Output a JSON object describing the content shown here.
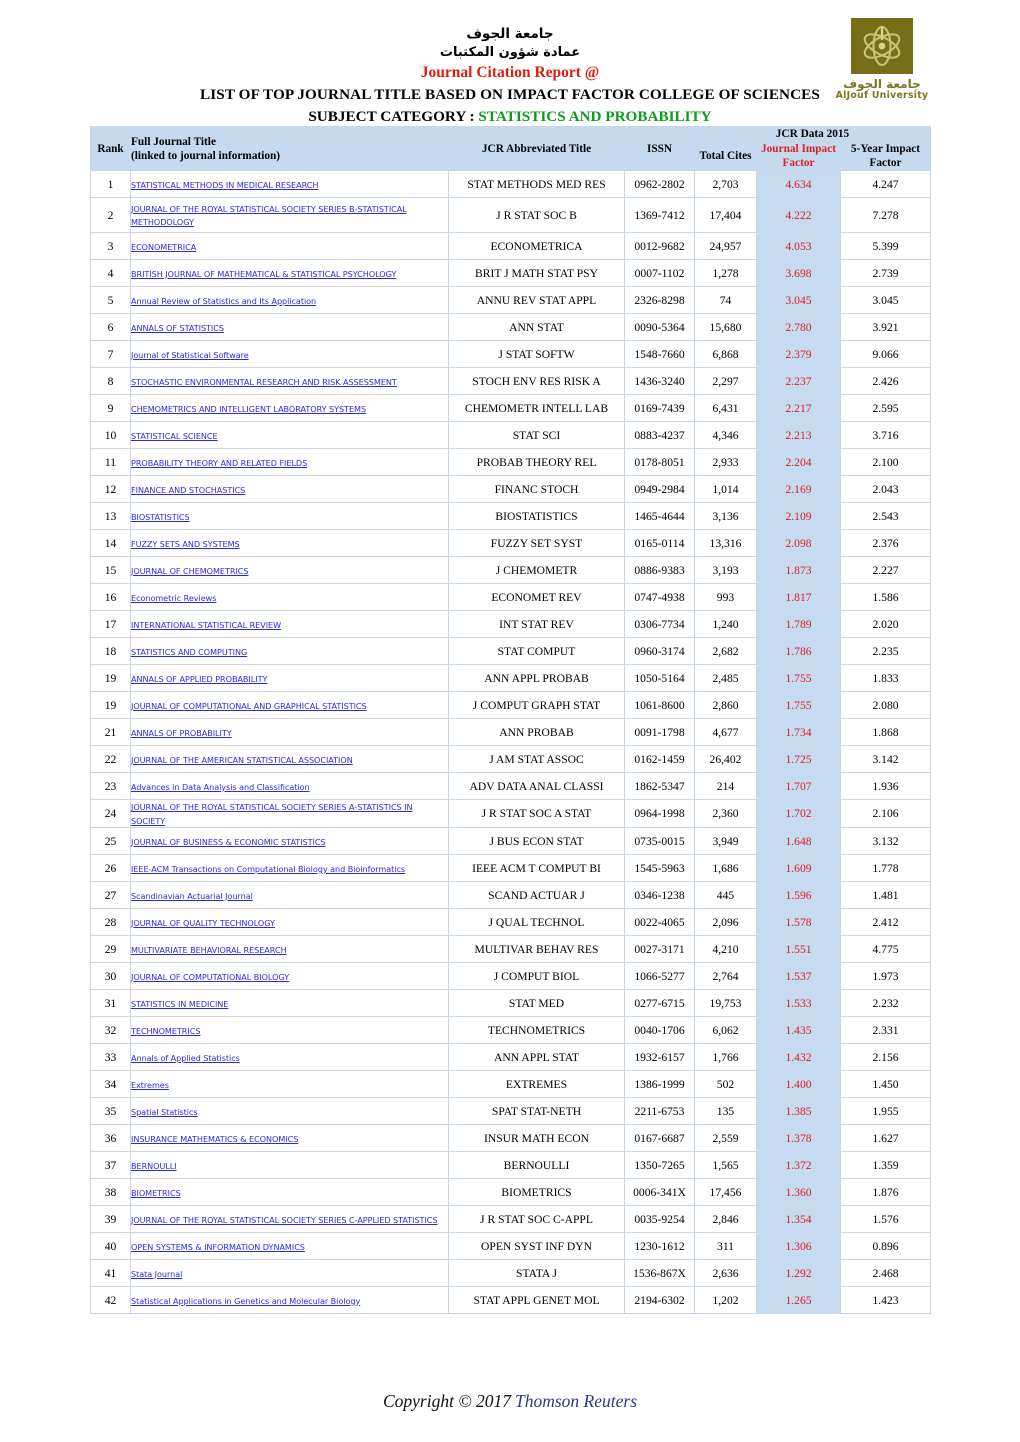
{
  "header": {
    "arabic_line1": "جامعة الجوف",
    "arabic_line2": "عمادة شؤون المكتبات",
    "report_title": "Journal Citation Report @",
    "list_title": "LIST OF TOP JOURNAL TITLE BASED ON IMPACT FACTOR COLLEGE OF SCIENCES",
    "subject_label": "SUBJECT CATEGORY :",
    "subject_value": "STATISTICS AND PROBABILITY",
    "colors": {
      "report_title": "#d91f11",
      "subject_value": "#0f9b1d",
      "logo": "#766f17",
      "impact_factor": "#e02020",
      "header_fill": "#c5d9ef",
      "jif_column_fill": "#c6daf0",
      "link": "#2b2bdd"
    }
  },
  "logo": {
    "arabic_name": "جامعة الجوف",
    "english_name": "AlJouf University"
  },
  "table": {
    "group_header": "JCR Data 2015",
    "columns": {
      "rank": "Rank",
      "full_title_line1": "Full Journal Title",
      "full_title_line2": "(linked to journal information)",
      "abbrev": "JCR Abbreviated Title",
      "issn": "ISSN",
      "total_cites": "Total Cites",
      "jif_line1": "Journal Impact",
      "jif_line2": "Factor",
      "fyif_line1": "5-Year Impact",
      "fyif_line2": "Factor"
    },
    "rows": [
      {
        "rank": "1",
        "title": "STATISTICAL METHODS IN MEDICAL RESEARCH",
        "abbr": "STAT METHODS MED RES",
        "issn": "0962-2802",
        "cites": "2,703",
        "jif": "4.634",
        "fyif": "4.247"
      },
      {
        "rank": "2",
        "title": "JOURNAL OF THE ROYAL STATISTICAL SOCIETY SERIES B-STATISTICAL METHODOLOGY",
        "abbr": "J R STAT SOC B",
        "issn": "1369-7412",
        "cites": "17,404",
        "jif": "4.222",
        "fyif": "7.278",
        "tall": true
      },
      {
        "rank": "3",
        "title": "ECONOMETRICA",
        "abbr": "ECONOMETRICA",
        "issn": "0012-9682",
        "cites": "24,957",
        "jif": "4.053",
        "fyif": "5.399"
      },
      {
        "rank": "4",
        "title": "BRITISH JOURNAL OF MATHEMATICAL & STATISTICAL PSYCHOLOGY",
        "abbr": "BRIT J MATH STAT PSY",
        "issn": "0007-1102",
        "cites": "1,278",
        "jif": "3.698",
        "fyif": "2.739"
      },
      {
        "rank": "5",
        "title": "Annual Review of Statistics and Its Application",
        "abbr": "ANNU REV STAT APPL",
        "issn": "2326-8298",
        "cites": "74",
        "jif": "3.045",
        "fyif": "3.045"
      },
      {
        "rank": "6",
        "title": "ANNALS OF STATISTICS",
        "abbr": "ANN STAT",
        "issn": "0090-5364",
        "cites": "15,680",
        "jif": "2.780",
        "fyif": "3.921"
      },
      {
        "rank": "7",
        "title": "Journal of Statistical Software",
        "abbr": "J STAT SOFTW",
        "issn": "1548-7660",
        "cites": "6,868",
        "jif": "2.379",
        "fyif": "9.066"
      },
      {
        "rank": "8",
        "title": "STOCHASTIC ENVIRONMENTAL RESEARCH AND RISK ASSESSMENT",
        "abbr": "STOCH ENV RES RISK A",
        "issn": "1436-3240",
        "cites": "2,297",
        "jif": "2.237",
        "fyif": "2.426"
      },
      {
        "rank": "9",
        "title": "CHEMOMETRICS AND INTELLIGENT LABORATORY SYSTEMS",
        "abbr": "CHEMOMETR INTELL LAB",
        "issn": "0169-7439",
        "cites": "6,431",
        "jif": "2.217",
        "fyif": "2.595"
      },
      {
        "rank": "10",
        "title": "STATISTICAL SCIENCE",
        "abbr": "STAT SCI",
        "issn": "0883-4237",
        "cites": "4,346",
        "jif": "2.213",
        "fyif": "3.716"
      },
      {
        "rank": "11",
        "title": "PROBABILITY THEORY AND RELATED FIELDS",
        "abbr": "PROBAB THEORY REL",
        "issn": "0178-8051",
        "cites": "2,933",
        "jif": "2.204",
        "fyif": "2.100"
      },
      {
        "rank": "12",
        "title": "FINANCE AND STOCHASTICS",
        "abbr": "FINANC STOCH",
        "issn": "0949-2984",
        "cites": "1,014",
        "jif": "2.169",
        "fyif": "2.043"
      },
      {
        "rank": "13",
        "title": "BIOSTATISTICS",
        "abbr": "BIOSTATISTICS",
        "issn": "1465-4644",
        "cites": "3,136",
        "jif": "2.109",
        "fyif": "2.543"
      },
      {
        "rank": "14",
        "title": "FUZZY SETS AND SYSTEMS",
        "abbr": "FUZZY SET SYST",
        "issn": "0165-0114",
        "cites": "13,316",
        "jif": "2.098",
        "fyif": "2.376"
      },
      {
        "rank": "15",
        "title": "JOURNAL OF CHEMOMETRICS",
        "abbr": "J CHEMOMETR",
        "issn": "0886-9383",
        "cites": "3,193",
        "jif": "1.873",
        "fyif": "2.227"
      },
      {
        "rank": "16",
        "title": "Econometric Reviews",
        "abbr": "ECONOMET REV",
        "issn": "0747-4938",
        "cites": "993",
        "jif": "1.817",
        "fyif": "1.586"
      },
      {
        "rank": "17",
        "title": "INTERNATIONAL STATISTICAL REVIEW",
        "abbr": "INT STAT REV",
        "issn": "0306-7734",
        "cites": "1,240",
        "jif": "1.789",
        "fyif": "2.020"
      },
      {
        "rank": "18",
        "title": "STATISTICS AND COMPUTING",
        "abbr": "STAT COMPUT",
        "issn": "0960-3174",
        "cites": "2,682",
        "jif": "1.786",
        "fyif": "2.235"
      },
      {
        "rank": "19",
        "title": "ANNALS OF APPLIED PROBABILITY",
        "abbr": "ANN APPL PROBAB",
        "issn": "1050-5164",
        "cites": "2,485",
        "jif": "1.755",
        "fyif": "1.833"
      },
      {
        "rank": "19",
        "title": "JOURNAL OF COMPUTATIONAL AND GRAPHICAL STATISTICS",
        "abbr": "J COMPUT GRAPH STAT",
        "issn": "1061-8600",
        "cites": "2,860",
        "jif": "1.755",
        "fyif": "2.080"
      },
      {
        "rank": "21",
        "title": "ANNALS OF PROBABILITY",
        "abbr": "ANN PROBAB",
        "issn": "0091-1798",
        "cites": "4,677",
        "jif": "1.734",
        "fyif": "1.868"
      },
      {
        "rank": "22",
        "title": "JOURNAL OF THE AMERICAN STATISTICAL ASSOCIATION",
        "abbr": "J AM STAT ASSOC",
        "issn": "0162-1459",
        "cites": "26,402",
        "jif": "1.725",
        "fyif": "3.142"
      },
      {
        "rank": "23",
        "title": "Advances in Data Analysis and Classification",
        "abbr": "ADV DATA ANAL CLASSI",
        "issn": "1862-5347",
        "cites": "214",
        "jif": "1.707",
        "fyif": "1.936"
      },
      {
        "rank": "24",
        "title": "JOURNAL OF THE ROYAL STATISTICAL SOCIETY SERIES A-STATISTICS IN SOCIETY",
        "abbr": "J R STAT SOC A STAT",
        "issn": "0964-1998",
        "cites": "2,360",
        "jif": "1.702",
        "fyif": "2.106"
      },
      {
        "rank": "25",
        "title": "JOURNAL OF BUSINESS & ECONOMIC STATISTICS",
        "abbr": "J BUS ECON STAT",
        "issn": "0735-0015",
        "cites": "3,949",
        "jif": "1.648",
        "fyif": "3.132"
      },
      {
        "rank": "26",
        "title": "IEEE-ACM Transactions on Computational Biology and Bioinformatics",
        "abbr": "IEEE ACM T COMPUT BI",
        "issn": "1545-5963",
        "cites": "1,686",
        "jif": "1.609",
        "fyif": "1.778"
      },
      {
        "rank": "27",
        "title": "Scandinavian Actuarial Journal",
        "abbr": "SCAND ACTUAR J",
        "issn": "0346-1238",
        "cites": "445",
        "jif": "1.596",
        "fyif": "1.481"
      },
      {
        "rank": "28",
        "title": "JOURNAL OF QUALITY TECHNOLOGY",
        "abbr": "J QUAL TECHNOL",
        "issn": "0022-4065",
        "cites": "2,096",
        "jif": "1.578",
        "fyif": "2.412"
      },
      {
        "rank": "29",
        "title": "MULTIVARIATE BEHAVIORAL RESEARCH",
        "abbr": "MULTIVAR BEHAV RES",
        "issn": "0027-3171",
        "cites": "4,210",
        "jif": "1.551",
        "fyif": "4.775"
      },
      {
        "rank": "30",
        "title": "JOURNAL OF COMPUTATIONAL BIOLOGY",
        "abbr": "J COMPUT BIOL",
        "issn": "1066-5277",
        "cites": "2,764",
        "jif": "1.537",
        "fyif": "1.973"
      },
      {
        "rank": "31",
        "title": "STATISTICS IN MEDICINE",
        "abbr": "STAT MED",
        "issn": "0277-6715",
        "cites": "19,753",
        "jif": "1.533",
        "fyif": "2.232"
      },
      {
        "rank": "32",
        "title": "TECHNOMETRICS",
        "abbr": "TECHNOMETRICS",
        "issn": "0040-1706",
        "cites": "6,062",
        "jif": "1.435",
        "fyif": "2.331"
      },
      {
        "rank": "33",
        "title": "Annals of Applied Statistics",
        "abbr": "ANN APPL STAT",
        "issn": "1932-6157",
        "cites": "1,766",
        "jif": "1.432",
        "fyif": "2.156"
      },
      {
        "rank": "34",
        "title": "Extremes",
        "abbr": "EXTREMES",
        "issn": "1386-1999",
        "cites": "502",
        "jif": "1.400",
        "fyif": "1.450"
      },
      {
        "rank": "35",
        "title": "Spatial Statistics",
        "abbr": "SPAT STAT-NETH",
        "issn": "2211-6753",
        "cites": "135",
        "jif": "1.385",
        "fyif": "1.955"
      },
      {
        "rank": "36",
        "title": "INSURANCE MATHEMATICS & ECONOMICS",
        "abbr": "INSUR MATH ECON",
        "issn": "0167-6687",
        "cites": "2,559",
        "jif": "1.378",
        "fyif": "1.627"
      },
      {
        "rank": "37",
        "title": "BERNOULLI",
        "abbr": "BERNOULLI",
        "issn": "1350-7265",
        "cites": "1,565",
        "jif": "1.372",
        "fyif": "1.359"
      },
      {
        "rank": "38",
        "title": "BIOMETRICS",
        "abbr": "BIOMETRICS",
        "issn": "0006-341X",
        "cites": "17,456",
        "jif": "1.360",
        "fyif": "1.876"
      },
      {
        "rank": "39",
        "title": "JOURNAL OF THE ROYAL STATISTICAL SOCIETY SERIES C-APPLIED STATISTICS",
        "abbr": "J R STAT SOC C-APPL",
        "issn": "0035-9254",
        "cites": "2,846",
        "jif": "1.354",
        "fyif": "1.576"
      },
      {
        "rank": "40",
        "title": "OPEN SYSTEMS & INFORMATION DYNAMICS",
        "abbr": "OPEN SYST INF DYN",
        "issn": "1230-1612",
        "cites": "311",
        "jif": "1.306",
        "fyif": "0.896"
      },
      {
        "rank": "41",
        "title": "Stata Journal",
        "abbr": "STATA J",
        "issn": "1536-867X",
        "cites": "2,636",
        "jif": "1.292",
        "fyif": "2.468"
      },
      {
        "rank": "42",
        "title": "Statistical Applications in Genetics and Molecular Biology",
        "abbr": "STAT APPL GENET MOL",
        "issn": "2194-6302",
        "cites": "1,202",
        "jif": "1.265",
        "fyif": "1.423"
      }
    ]
  },
  "footer": {
    "copyright": "Copyright © 2017",
    "brand": "Thomson Reuters"
  }
}
